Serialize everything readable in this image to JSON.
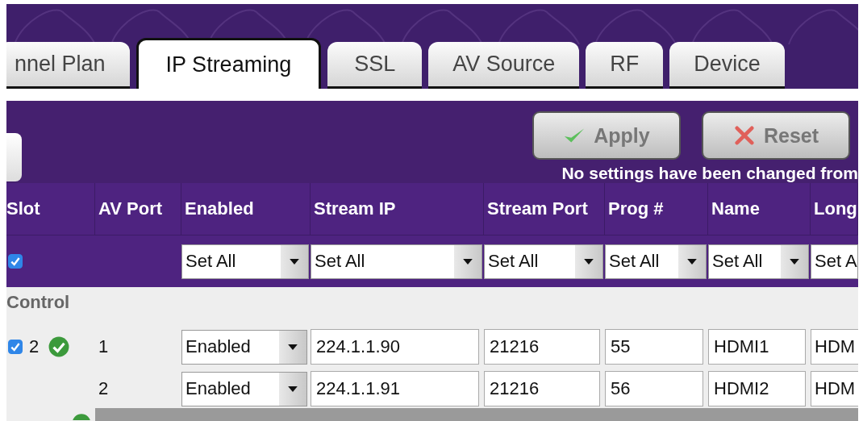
{
  "tabs": [
    {
      "label": "nnel Plan",
      "selected": false
    },
    {
      "label": "IP Streaming",
      "selected": true
    },
    {
      "label": "SSL",
      "selected": false
    },
    {
      "label": "AV Source",
      "selected": false
    },
    {
      "label": "RF",
      "selected": false
    },
    {
      "label": "Device",
      "selected": false
    }
  ],
  "buttons": [
    {
      "kind": "apply",
      "label": "Apply"
    },
    {
      "kind": "reset",
      "label": "Reset"
    }
  ],
  "message": "No settings have been changed from",
  "table": {
    "columns": [
      "Slot",
      "AV Port",
      "Enabled",
      "Stream IP",
      "Stream Port",
      "Prog #",
      "Name",
      "Long"
    ],
    "set_all": {
      "checked": true,
      "selects": [
        "Set All",
        "Set All",
        "Set All",
        "Set All",
        "Set All",
        "Set A"
      ]
    },
    "group": "Control",
    "rows": [
      {
        "checked": true,
        "slot": "2",
        "status_ok": true,
        "av_port": "1",
        "enabled": "Enabled",
        "stream_ip": "224.1.1.90",
        "stream_port": "21216",
        "prog": "55",
        "name": "HDMI1",
        "long": "HDM"
      },
      {
        "av_port": "2",
        "enabled": "Enabled",
        "stream_ip": "224.1.1.91",
        "stream_port": "21216",
        "prog": "56",
        "name": "HDMI2",
        "long": "HDM"
      }
    ]
  }
}
